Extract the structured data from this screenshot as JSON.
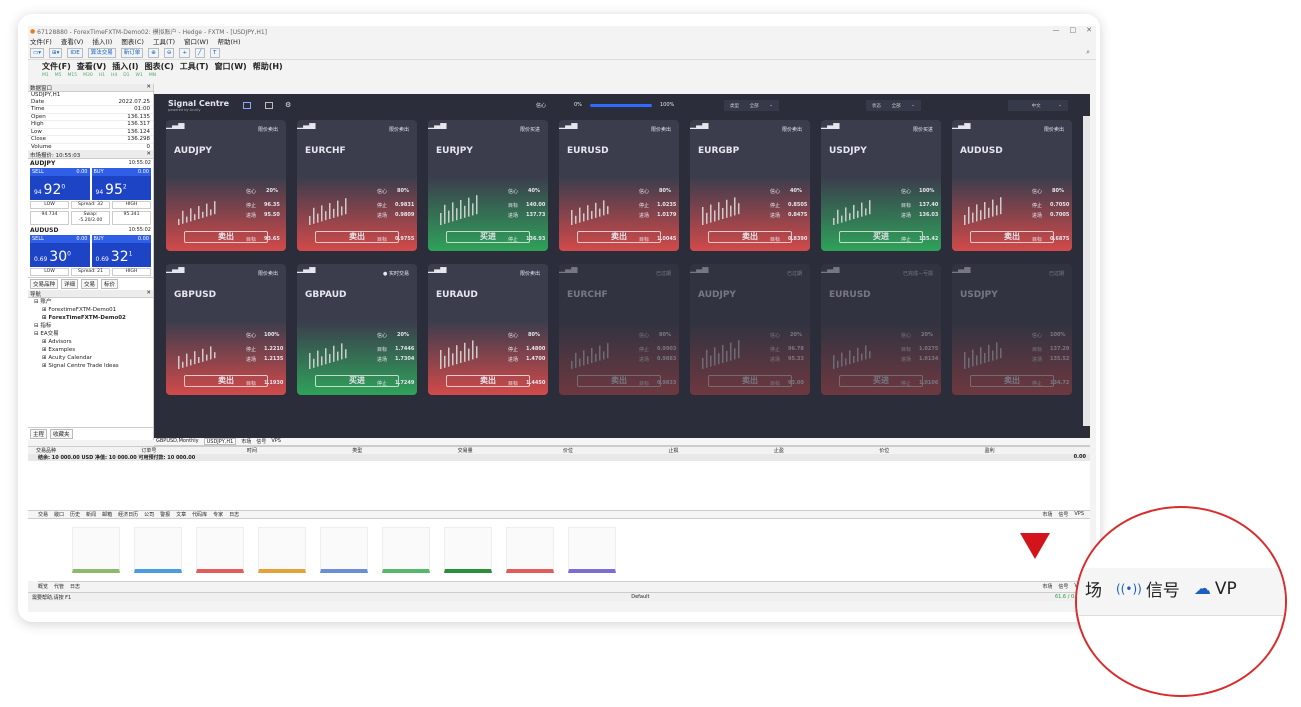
{
  "window": {
    "title": "67128880 - ForexTimeFXTM-Demo02: 模拟账户 - Hedge - FXTM - [USDJPY,H1]",
    "controls": [
      "—",
      "□",
      "✕"
    ]
  },
  "menu": [
    "文件(F)",
    "查看(V)",
    "插入(I)",
    "图表(C)",
    "工具(T)",
    "窗口(W)",
    "帮助(H)"
  ],
  "toolbar": {
    "auto_trade": "算法交易",
    "new_order": "新订单",
    "timeframes": [
      "M1",
      "M5",
      "M15",
      "M30",
      "H1",
      "H4",
      "D1",
      "W1",
      "MN"
    ]
  },
  "big_menu": [
    "文件(F)",
    "查看(V)",
    "插入(I)",
    "图表(C)",
    "工具(T)",
    "窗口(W)",
    "帮助(H)"
  ],
  "data_window": {
    "title": "数据窗口",
    "symbol": "USDJPY,H1",
    "rows": [
      [
        "Date",
        "2022.07.25"
      ],
      [
        "Time",
        "01:00"
      ],
      [
        "Open",
        "136.135"
      ],
      [
        "High",
        "136.317"
      ],
      [
        "Low",
        "136.124"
      ],
      [
        "Close",
        "136.298"
      ],
      [
        "Volume",
        "0"
      ]
    ]
  },
  "market_watch": {
    "title": "市场报价: 10:55:03",
    "items": [
      {
        "symbol": "AUDJPY",
        "time": "10:55:02",
        "lot": "0.00",
        "sell_pre": "94",
        "sell_big": "92",
        "sell_sup": "0",
        "buy_pre": "94",
        "buy_big": "95",
        "buy_sup": "2",
        "low": "94.734",
        "spread": "Spread: 32",
        "high": "95.341",
        "swap": "Swap: -5.20/2.00"
      },
      {
        "symbol": "AUDUSD",
        "time": "10:55:02",
        "lot": "0.00",
        "sell_pre": "0.69",
        "sell_big": "30",
        "sell_sup": "0",
        "buy_pre": "0.69",
        "buy_big": "32",
        "buy_sup": "1",
        "low": "LOW",
        "spread": "Spread: 21",
        "high": "HIGH"
      }
    ],
    "sell": "SELL",
    "buy": "BUY",
    "low": "LOW",
    "high": "HIGH",
    "tabs": [
      "交易品种",
      "详细",
      "交易",
      "标价"
    ]
  },
  "navigator": {
    "title": "导航",
    "items": [
      "账户",
      "ForextimeFXTM-Demo01",
      "ForexTimeFXTM-Demo02",
      "指标",
      "EA交易",
      "Advisors",
      "Examples",
      "Acuity Calendar",
      "Signal Centre Trade Ideas"
    ],
    "tabs": [
      "主程",
      "收藏夹"
    ]
  },
  "signal_centre": {
    "logo": "Signal Centre",
    "logo_sub": "powered by Acuity",
    "conf_label": "信心",
    "conf_min": "0%",
    "conf_max": "100%",
    "filters": [
      {
        "label": "类型",
        "value": "全部"
      },
      {
        "label": "状态",
        "value": "全部"
      },
      {
        "label": "",
        "value": "中文"
      }
    ],
    "cards": [
      {
        "sym": "AUDJPY",
        "mode": "限价卖出",
        "l1": "信心",
        "v1": "20%",
        "l2": "停止",
        "v2": "96.35",
        "l3": "进场",
        "v3": "95.50",
        "l4": "目标",
        "v4": "93.65",
        "btn": "卖出",
        "kind": "sell"
      },
      {
        "sym": "EURCHF",
        "mode": "限价卖出",
        "l1": "信心",
        "v1": "80%",
        "l2": "停止",
        "v2": "0.9831",
        "l3": "进场",
        "v3": "0.9809",
        "l4": "目标",
        "v4": "0.9755",
        "btn": "卖出",
        "kind": "sell"
      },
      {
        "sym": "EURJPY",
        "mode": "限价买进",
        "l1": "信心",
        "v1": "40%",
        "l2": "目标",
        "v2": "140.00",
        "l3": "进场",
        "v3": "137.73",
        "l4": "停止",
        "v4": "136.93",
        "btn": "买进",
        "kind": "buy"
      },
      {
        "sym": "EURUSD",
        "mode": "限价卖出",
        "l1": "信心",
        "v1": "80%",
        "l2": "停止",
        "v2": "1.0235",
        "l3": "进场",
        "v3": "1.0179",
        "l4": "目标",
        "v4": "1.0045",
        "btn": "卖出",
        "kind": "sell"
      },
      {
        "sym": "EURGBP",
        "mode": "限价卖出",
        "l1": "信心",
        "v1": "40%",
        "l2": "停止",
        "v2": "0.8505",
        "l3": "进场",
        "v3": "0.8475",
        "l4": "目标",
        "v4": "0.8390",
        "btn": "卖出",
        "kind": "sell"
      },
      {
        "sym": "USDJPY",
        "mode": "限价买进",
        "l1": "信心",
        "v1": "100%",
        "l2": "目标",
        "v2": "137.40",
        "l3": "进场",
        "v3": "136.03",
        "l4": "停止",
        "v4": "135.42",
        "btn": "买进",
        "kind": "buy"
      },
      {
        "sym": "AUDUSD",
        "mode": "限价卖出",
        "l1": "信心",
        "v1": "80%",
        "l2": "停止",
        "v2": "0.7050",
        "l3": "进场",
        "v3": "0.7005",
        "l4": "目标",
        "v4": "0.6875",
        "btn": "卖出",
        "kind": "sell"
      },
      {
        "sym": "GBPUSD",
        "mode": "限价卖出",
        "l1": "信心",
        "v1": "100%",
        "l2": "停止",
        "v2": "1.2210",
        "l3": "进场",
        "v3": "1.2135",
        "l4": "目标",
        "v4": "1.1930",
        "btn": "卖出",
        "kind": "sell"
      },
      {
        "sym": "GBPAUD",
        "mode": "● 实时交易",
        "l1": "信心",
        "v1": "20%",
        "l2": "目标",
        "v2": "1.7446",
        "l3": "进场",
        "v3": "1.7304",
        "l4": "停止",
        "v4": "1.7249",
        "btn": "买进",
        "kind": "buy"
      },
      {
        "sym": "EURAUD",
        "mode": "限价卖出",
        "l1": "信心",
        "v1": "80%",
        "l2": "停止",
        "v2": "1.4800",
        "l3": "进场",
        "v3": "1.4700",
        "l4": "目标",
        "v4": "1.4450",
        "btn": "卖出",
        "kind": "sell"
      },
      {
        "sym": "EURCHF",
        "mode": "已过期",
        "l1": "信心",
        "v1": "80%",
        "l2": "停止",
        "v2": "0.9903",
        "l3": "进场",
        "v3": "0.9883",
        "l4": "目标",
        "v4": "0.9833",
        "btn": "卖出",
        "kind": "dim"
      },
      {
        "sym": "AUDJPY",
        "mode": "已过期",
        "l1": "信心",
        "v1": "20%",
        "l2": "停止",
        "v2": "96.78",
        "l3": "进场",
        "v3": "95.33",
        "l4": "目标",
        "v4": "93.00",
        "btn": "卖出",
        "kind": "dim"
      },
      {
        "sym": "EURUSD",
        "mode": "已完成—亏损",
        "l1": "信心",
        "v1": "20%",
        "l2": "目标",
        "v2": "1.0275",
        "l3": "进场",
        "v3": "1.0134",
        "l4": "停止",
        "v4": "1.0106",
        "btn": "买进",
        "kind": "dim"
      },
      {
        "sym": "USDJPY",
        "mode": "已过期",
        "l1": "信心",
        "v1": "100%",
        "l2": "目标",
        "v2": "137.29",
        "l3": "进场",
        "v3": "135.52",
        "l4": "停止",
        "v4": "134.72",
        "btn": "卖出",
        "kind": "dim"
      }
    ]
  },
  "chart_tabs": [
    "GBPUSD,Monthly",
    "USDJPY,H1",
    "市场",
    "信号",
    "VPS"
  ],
  "terminal": {
    "headers": [
      "交易品种",
      "订单号",
      "时间",
      "类型",
      "交易量",
      "价位",
      "止损",
      "止盈",
      "价位",
      "盈利"
    ],
    "balance": "结余: 10 000.00 USD 净值: 10 000.00 可用预付款: 10 000.00",
    "balance_value": "0.00"
  },
  "terminal_tabs": [
    "交易",
    "敞口",
    "历史",
    "新闻",
    "邮箱",
    "经济日历",
    "公司",
    "警报",
    "文章",
    "代码库",
    "专家",
    "日志"
  ],
  "market_tabs": [
    "概览",
    "代管",
    "日志"
  ],
  "right_links": [
    "市场",
    "信号",
    "VPS"
  ],
  "status": {
    "help": "需要帮助,请按 F1",
    "profile": "Default",
    "traffic": "61.6 / 0.0 Mb"
  },
  "zoom": {
    "market": "场",
    "signal_icon": "((•))",
    "signal": "信号",
    "vps": "VP"
  }
}
